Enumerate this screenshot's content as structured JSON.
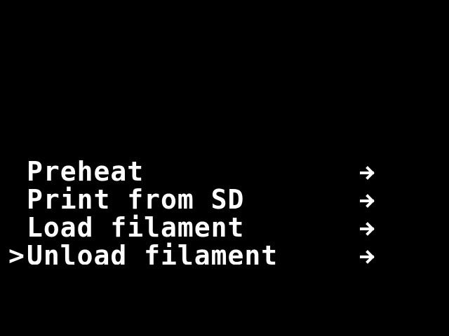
{
  "screen": {
    "background": "#000000",
    "foreground": "#ffffff"
  },
  "menu": {
    "cursor": ">",
    "items": [
      {
        "label": "Preheat",
        "icon": "arrow-right-icon",
        "selected": false
      },
      {
        "label": "Print from SD",
        "icon": "arrow-right-icon",
        "selected": false
      },
      {
        "label": "Load filament",
        "icon": "arrow-right-icon",
        "selected": false
      },
      {
        "label": "Unload filament",
        "icon": "arrow-right-icon",
        "selected": true
      }
    ]
  }
}
